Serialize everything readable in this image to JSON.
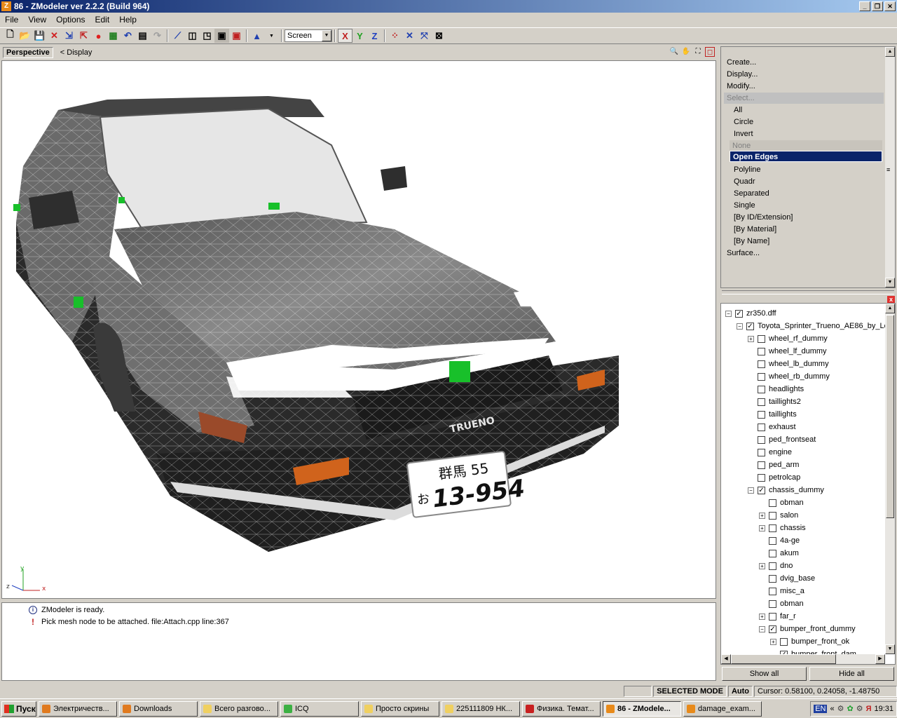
{
  "window": {
    "title": "86 - ZModeler ver 2.2.2 (Build 964)",
    "app_icon": "Z"
  },
  "menu": [
    "File",
    "View",
    "Options",
    "Edit",
    "Help"
  ],
  "toolbar": {
    "screen_select": "Screen",
    "axis_x": "X",
    "axis_y": "Y",
    "axis_z": "Z"
  },
  "viewport": {
    "mode": "Perspective",
    "display": "<  Display",
    "axis_labels": {
      "y": "y",
      "z": "z",
      "x": "x"
    }
  },
  "car": {
    "plate_top": "群馬 55",
    "plate_prefix": "お",
    "plate_number": "13-954",
    "badge": "TRUENO"
  },
  "commands": {
    "create": "Create...",
    "display": "Display...",
    "modify": "Modify...",
    "select": "Select...",
    "select_items": [
      "All",
      "Circle",
      "Invert"
    ],
    "none": "None",
    "open_edges": "Open Edges",
    "select_items2": [
      "Polyline",
      "Quadr",
      "Separated",
      "Single",
      "[By ID/Extension]",
      "[By Material]",
      "[By Name]"
    ],
    "surface": "Surface..."
  },
  "tree": [
    {
      "label": "zr350.dff",
      "exp": "−",
      "checked": true,
      "x": 6
    },
    {
      "label": "Toyota_Sprinter_Trueno_AE86_by_Le",
      "exp": "−",
      "checked": true,
      "x": 22
    },
    {
      "label": "wheel_rf_dummy",
      "exp": "+",
      "checked": false,
      "x": 38
    },
    {
      "label": "wheel_lf_dummy",
      "exp": "",
      "checked": false,
      "x": 38
    },
    {
      "label": "wheel_lb_dummy",
      "exp": "",
      "checked": false,
      "x": 38
    },
    {
      "label": "wheel_rb_dummy",
      "exp": "",
      "checked": false,
      "x": 38
    },
    {
      "label": "headlights",
      "exp": "",
      "checked": false,
      "x": 38
    },
    {
      "label": "taillights2",
      "exp": "",
      "checked": false,
      "x": 38
    },
    {
      "label": "taillights",
      "exp": "",
      "checked": false,
      "x": 38
    },
    {
      "label": "exhaust",
      "exp": "",
      "checked": false,
      "x": 38
    },
    {
      "label": "ped_frontseat",
      "exp": "",
      "checked": false,
      "x": 38
    },
    {
      "label": "engine",
      "exp": "",
      "checked": false,
      "x": 38
    },
    {
      "label": "ped_arm",
      "exp": "",
      "checked": false,
      "x": 38
    },
    {
      "label": "petrolcap",
      "exp": "",
      "checked": false,
      "x": 38
    },
    {
      "label": "chassis_dummy",
      "exp": "−",
      "checked": true,
      "x": 38
    },
    {
      "label": "obman",
      "exp": "",
      "checked": false,
      "x": 54
    },
    {
      "label": "salon",
      "exp": "+",
      "checked": false,
      "x": 54
    },
    {
      "label": "chassis",
      "exp": "+",
      "checked": false,
      "x": 54
    },
    {
      "label": "4a-ge",
      "exp": "",
      "checked": false,
      "x": 54
    },
    {
      "label": "akum",
      "exp": "",
      "checked": false,
      "x": 54
    },
    {
      "label": "dno",
      "exp": "+",
      "checked": false,
      "x": 54
    },
    {
      "label": "dvig_base",
      "exp": "",
      "checked": false,
      "x": 54
    },
    {
      "label": "misc_a",
      "exp": "",
      "checked": false,
      "x": 54
    },
    {
      "label": "obman",
      "exp": "",
      "checked": false,
      "x": 54
    },
    {
      "label": "far_r",
      "exp": "+",
      "checked": false,
      "x": 54
    },
    {
      "label": "bumper_front_dummy",
      "exp": "−",
      "checked": true,
      "x": 54
    },
    {
      "label": "bumper_front_ok",
      "exp": "+",
      "checked": false,
      "x": 70
    },
    {
      "label": "bumper_front_dam",
      "exp": "",
      "checked": true,
      "x": 70
    }
  ],
  "buttons": {
    "show_all": "Show all",
    "hide_all": "Hide all"
  },
  "log": [
    {
      "icon": "info-icon",
      "text": "ZModeler is ready."
    },
    {
      "icon": "warning-icon",
      "text": "Pick mesh node to be attached. file:Attach.cpp line:367"
    }
  ],
  "status": {
    "mode": "SELECTED MODE",
    "auto": "Auto",
    "cursor": "Cursor: 0.58100, 0.24058, -1.48750"
  },
  "taskbar": {
    "start": "Пуск",
    "tasks": [
      {
        "label": "Электричеств...",
        "color": "#e07a1f"
      },
      {
        "label": "Downloads",
        "color": "#e07a1f"
      },
      {
        "label": "Всего разгово...",
        "color": "#f0d060"
      },
      {
        "label": "ICQ",
        "color": "#3cb043"
      },
      {
        "label": "Просто скрины",
        "color": "#f0d060"
      },
      {
        "label": "225111809 НК...",
        "color": "#f0d060"
      },
      {
        "label": "Физика. Темат...",
        "color": "#c82020"
      },
      {
        "label": "86 - ZModele...",
        "color": "#e88a1a",
        "active": true
      },
      {
        "label": "damage_exam...",
        "color": "#e88a1a"
      }
    ],
    "lang": "EN",
    "clock": "19:31"
  }
}
